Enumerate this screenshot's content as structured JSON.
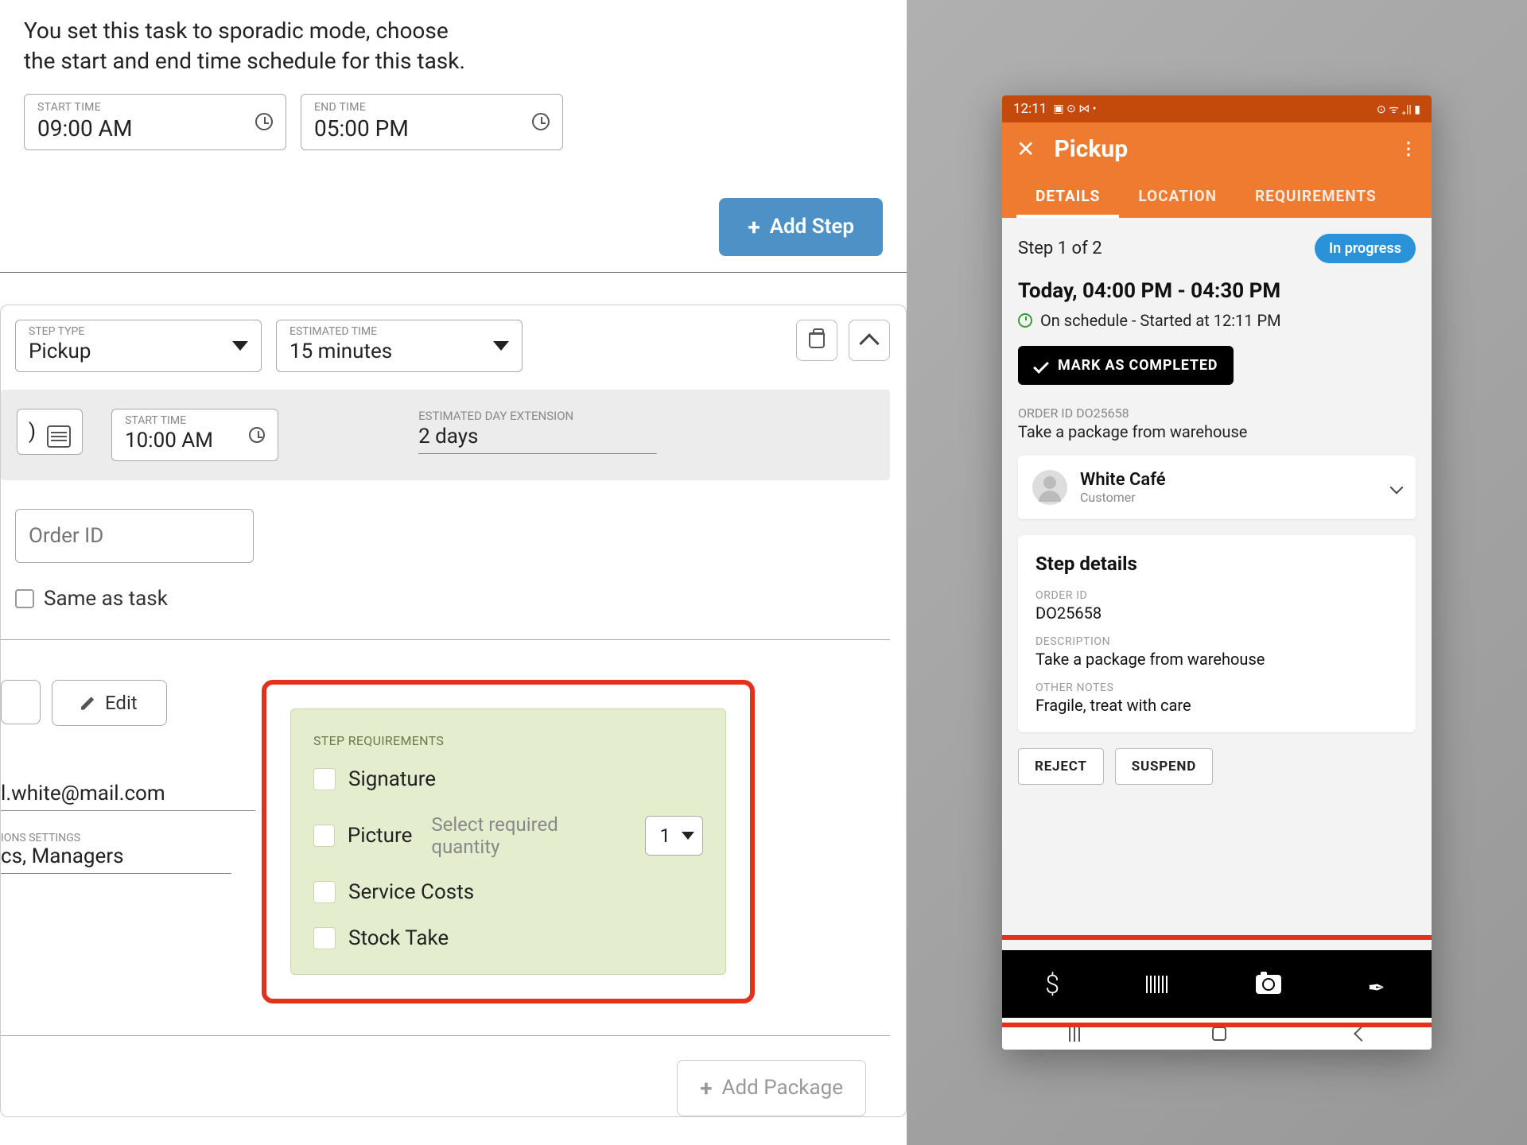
{
  "left": {
    "intro": "You set this task to sporadic mode, choose the start and end time schedule for this task.",
    "start_time_label": "START TIME",
    "start_time_value": "09:00 AM",
    "end_time_label": "END TIME",
    "end_time_value": "05:00 PM",
    "add_step": "Add Step",
    "step_type_label": "STEP TYPE",
    "step_type_value": "Pickup",
    "est_time_label": "ESTIMATED TIME",
    "est_time_value": "15 minutes",
    "inner_start_label": "START TIME",
    "inner_start_value": "10:00 AM",
    "ext_label": "ESTIMATED DAY EXTENSION",
    "ext_value": "2 days",
    "order_id_placeholder": "Order ID",
    "same_as_task": "Same as task",
    "edit": "Edit",
    "email": "l.white@mail.com",
    "perm_label": "IONS SETTINGS",
    "perm_value": "cs, Managers",
    "step_req_title": "STEP REQUIREMENTS",
    "req_signature": "Signature",
    "req_picture": "Picture",
    "req_qty_hint": "Select required quantity",
    "req_qty_value": "1",
    "req_service": "Service Costs",
    "req_stock": "Stock Take",
    "add_package": "Add Package"
  },
  "phone": {
    "status_time": "12:11",
    "title": "Pickup",
    "tabs": {
      "details": "DETAILS",
      "location": "LOCATION",
      "requirements": "REQUIREMENTS"
    },
    "step_of": "Step 1 of 2",
    "badge": "In progress",
    "time_heading": "Today, 04:00 PM - 04:30 PM",
    "schedule": "On schedule - Started at 12:11 PM",
    "mark_completed": "MARK AS COMPLETED",
    "order_id_label": "ORDER ID DO25658",
    "order_desc": "Take a package from warehouse",
    "customer_name": "White Café",
    "customer_role": "Customer",
    "step_details": "Step details",
    "d_order_label": "ORDER ID",
    "d_order_value": "DO25658",
    "d_desc_label": "DESCRIPTION",
    "d_desc_value": "Take a package from warehouse",
    "d_notes_label": "OTHER NOTES",
    "d_notes_value": "Fragile, treat with care",
    "reject": "REJECT",
    "suspend": "SUSPEND"
  }
}
